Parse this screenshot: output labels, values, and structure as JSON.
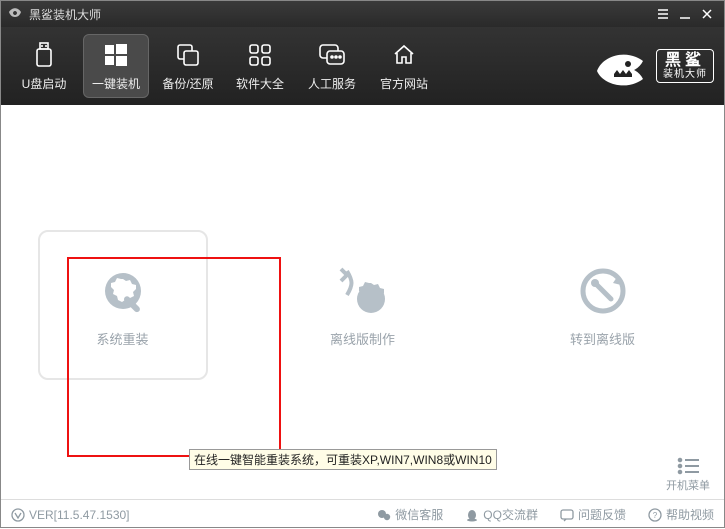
{
  "titlebar": {
    "title": "黑鲨装机大师"
  },
  "toolbar": {
    "items": [
      {
        "label": "U盘启动"
      },
      {
        "label": "一键装机"
      },
      {
        "label": "备份/还原"
      },
      {
        "label": "软件大全"
      },
      {
        "label": "人工服务"
      },
      {
        "label": "官方网站"
      }
    ]
  },
  "brand": {
    "big": "黑鲨",
    "small": "装机大师"
  },
  "main": {
    "options": [
      {
        "label": "系统重装"
      },
      {
        "label": "离线版制作"
      },
      {
        "label": "转到离线版"
      }
    ],
    "tooltip": "在线一键智能重装系统，可重装XP,WIN7,WIN8或WIN10",
    "boot_menu": "开机菜单"
  },
  "statusbar": {
    "version": "VER[11.5.47.1530]",
    "items": [
      {
        "label": "微信客服"
      },
      {
        "label": "QQ交流群"
      },
      {
        "label": "问题反馈"
      },
      {
        "label": "帮助视频"
      }
    ]
  }
}
